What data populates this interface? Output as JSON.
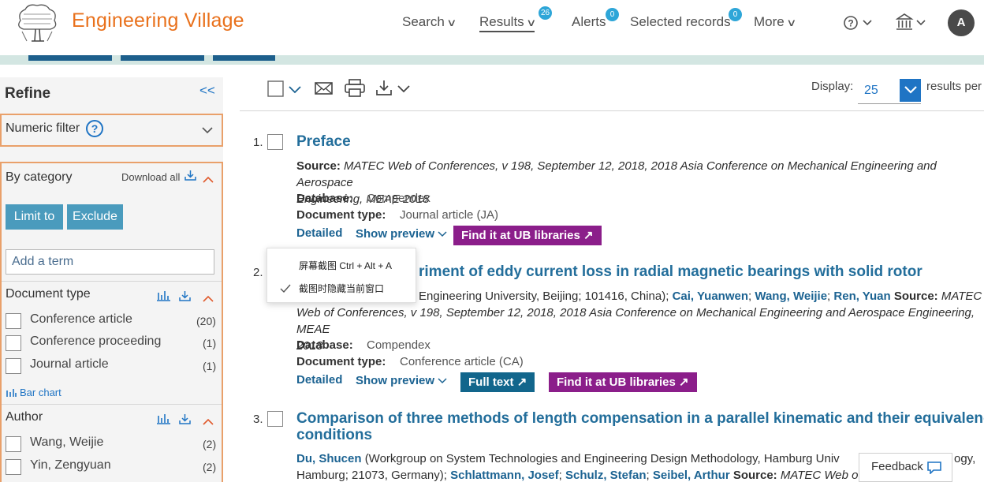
{
  "header": {
    "brand": "Engineering Village",
    "nav": {
      "search": "Search",
      "results": "Results",
      "results_badge": "26",
      "alerts": "Alerts",
      "alerts_badge": "0",
      "selected": "Selected records",
      "selected_badge": "0",
      "more": "More"
    },
    "avatar_initial": "A",
    "icons": [
      "help-icon",
      "institution-icon"
    ]
  },
  "sidebar": {
    "title": "Refine",
    "collapse": "<<",
    "numeric_filter": "Numeric filter",
    "by_category": "By category",
    "download_all": "Download all",
    "limit_to": "Limit to",
    "exclude": "Exclude",
    "add_term_placeholder": "Add a term",
    "doc_type": {
      "title": "Document type",
      "items": [
        {
          "label": "Conference article",
          "count": "(20)"
        },
        {
          "label": "Conference proceeding",
          "count": "(1)"
        },
        {
          "label": "Journal article",
          "count": "(1)"
        }
      ],
      "bar_chart": "Bar chart"
    },
    "author": {
      "title": "Author",
      "items": [
        {
          "label": "Wang, Weijie",
          "count": "(2)"
        },
        {
          "label": "Yin, Zengyuan",
          "count": "(2)"
        }
      ]
    }
  },
  "toolbar": {
    "display_label": "Display:",
    "display_value": "25",
    "results_per": "results per"
  },
  "results": [
    {
      "num": "1.",
      "title": "Preface",
      "source_label": "Source:",
      "source": "MATEC Web of Conferences, v 198, September 12, 2018, 2018 Asia Conference on Mechanical Engineering and Aerospace",
      "source_cont": "Engineering, MEAE 2018",
      "database_label": "Database:",
      "database": "Compendex",
      "doctype_label": "Document type:",
      "doctype": "Journal article (JA)",
      "detailed": "Detailed",
      "preview": "Show preview",
      "find_it": "Find it at UB libraries"
    },
    {
      "num": "2.",
      "title": "riment of eddy current loss in radial magnetic bearings with solid rotor",
      "aff": "Engineering University, Beijing; 101416, China);",
      "author1": "Cai, Yuanwen",
      "author2": "Wang, Weijie",
      "author3": "Ren, Yuan",
      "source_label": "Source:",
      "source_a": "MATEC",
      "source_b": "Web of Conferences, v 198, September 12, 2018, 2018 Asia Conference on Mechanical Engineering and Aerospace Engineering, MEAE",
      "source_c": "2018",
      "database_label": "Database:",
      "database": "Compendex",
      "doctype_label": "Document type:",
      "doctype": "Conference article (CA)",
      "detailed": "Detailed",
      "preview": "Show preview",
      "full_text": "Full text",
      "find_it": "Find it at UB libraries"
    },
    {
      "num": "3.",
      "title": "Comparison of three methods of length compensation in a parallel kinematic and their equivalence",
      "title_cont": "conditions",
      "author1": "Du, Shucen",
      "aff1": "(Workgroup on System Technologies and Engineering Design Methodology, Hamburg Univ",
      "aff1_tail": "ogy,",
      "aff2": "Hamburg; 21073, Germany);",
      "author2": "Schlattmann, Josef",
      "author3": "Schulz, Stefan",
      "author4": "Seibel, Arthur",
      "source_label": "Source:",
      "source": "MATEC Web of C"
    }
  ],
  "context_menu": {
    "item1": "屏幕截图 Ctrl + Alt + A",
    "item2": "截图时隐藏当前窗口"
  },
  "feedback": "Feedback"
}
